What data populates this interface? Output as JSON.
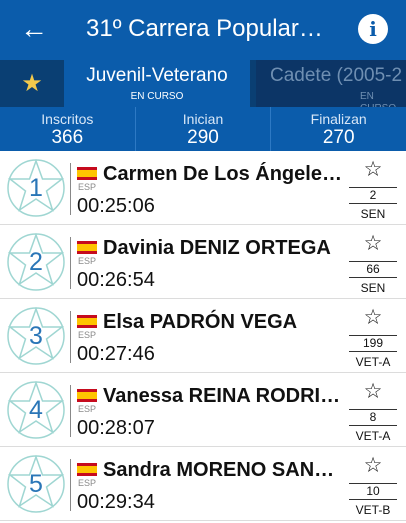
{
  "appbar": {
    "title": "31º Carrera Popular…",
    "back_icon": "arrow-left-icon",
    "info_icon": "info-icon"
  },
  "colors": {
    "primary": "#0b5cab",
    "primary_dark": "#0a3f73",
    "star_accent": "#f2c94c",
    "badge_outline": "#9fd6d2",
    "badge_number": "#2a76b7"
  },
  "tabs": [
    {
      "label": "Juvenil-Veterano",
      "status": "EN CURSO"
    },
    {
      "label": "Cadete (2005-2",
      "status": "EN CURSO"
    }
  ],
  "stats": [
    {
      "label": "Inscritos",
      "value": "366"
    },
    {
      "label": "Inician",
      "value": "290"
    },
    {
      "label": "Finalizan",
      "value": "270"
    }
  ],
  "runners": [
    {
      "position": "1",
      "country": "ESP",
      "name": "Carmen De Los Ángeles…",
      "time": "00:25:06",
      "dorsal": "2",
      "category": "SEN"
    },
    {
      "position": "2",
      "country": "ESP",
      "name": "Davinia DENIZ ORTEGA",
      "time": "00:26:54",
      "dorsal": "66",
      "category": "SEN"
    },
    {
      "position": "3",
      "country": "ESP",
      "name": "Elsa PADRÓN VEGA",
      "time": "00:27:46",
      "dorsal": "199",
      "category": "VET-A"
    },
    {
      "position": "4",
      "country": "ESP",
      "name": "Vanessa REINA RODRIG…",
      "time": "00:28:07",
      "dorsal": "8",
      "category": "VET-A"
    },
    {
      "position": "5",
      "country": "ESP",
      "name": "Sandra MORENO SANTI…",
      "time": "00:29:34",
      "dorsal": "10",
      "category": "VET-B"
    }
  ]
}
